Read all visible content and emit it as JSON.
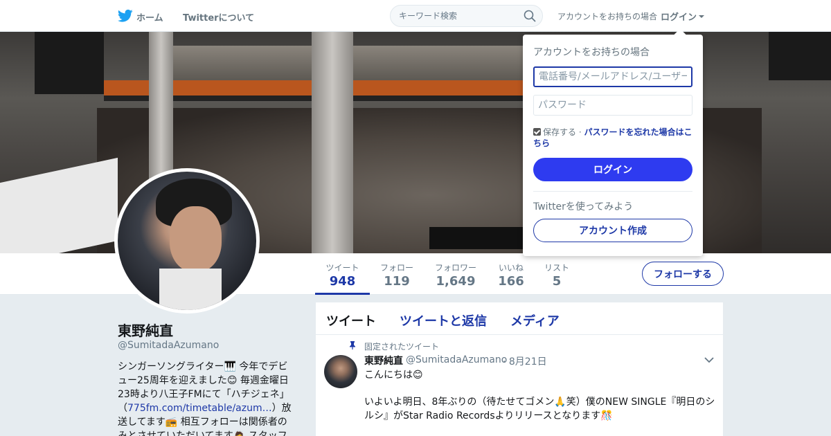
{
  "topnav": {
    "home_label": "ホーム",
    "about_label": "Twitterについて",
    "search_placeholder": "キーワード検索",
    "login_prompt": "アカウントをお持ちの場合",
    "login_link": "ログイン",
    "brand_color": "#1da1f2"
  },
  "profile": {
    "name": "東野純直",
    "handle": "@SumitadaAzumano",
    "bio_part1": "シンガーソングライター🎹 今年でデビュー25周年を迎えました😊 毎週金曜日23時より八王子FMにて「ハチジェネ」（",
    "bio_link": "775fm.com/timetable/azum…",
    "bio_part2": "）放送してます📻 相互フォローは関係者のみとさせていただいてます🙇 スタッフア力"
  },
  "stats": [
    {
      "label": "ツイート",
      "value": "948"
    },
    {
      "label": "フォロー",
      "value": "119"
    },
    {
      "label": "フォロワー",
      "value": "1,649"
    },
    {
      "label": "いいね",
      "value": "166"
    },
    {
      "label": "リスト",
      "value": "5"
    }
  ],
  "follow_button": "フォローする",
  "timeline": {
    "tabs": [
      "ツイート",
      "ツイートと返信",
      "メディア"
    ],
    "pinned_label": "固定されたツイート",
    "tweet": {
      "name": "東野純直",
      "handle": "@SumitadaAzumano",
      "date": "· 8月21日",
      "line1": "こんにちは😊",
      "line2": "いよいよ明日、8年ぶりの（待たせてゴメン🙏笑）僕のNEW SINGLE『明日のシルシ』がStar Radio Recordsよりリリースとなります🎊"
    }
  },
  "login_dropdown": {
    "title": "アカウントをお持ちの場合",
    "username_placeholder": "電話番号/メールアドレス/ユーザー名",
    "password_placeholder": "パスワード",
    "remember_label": "保存する ·",
    "forgot_link": "パスワードを忘れた場合はこちら",
    "login_button": "ログイン",
    "try_label": "Twitterを使ってみよう",
    "signup_button": "アカウント作成"
  },
  "colors": {
    "accent": "#1d38a7",
    "login_button": "#2e3bf0",
    "background": "#e6ecf0"
  }
}
